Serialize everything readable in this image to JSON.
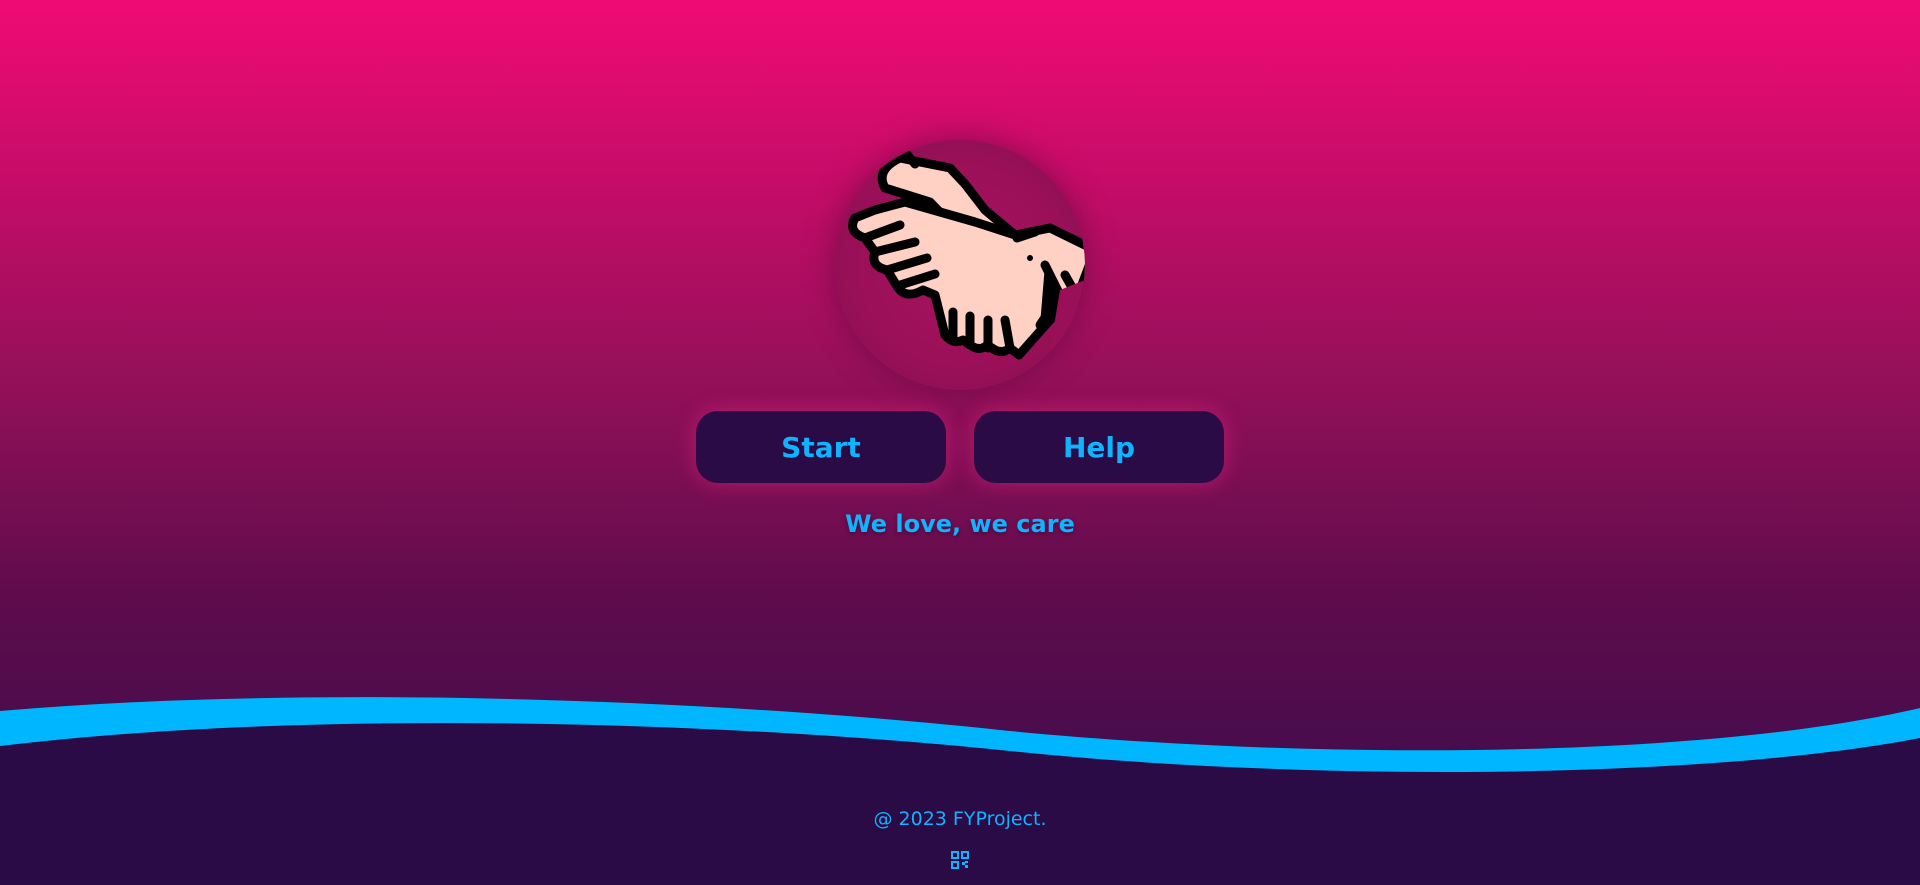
{
  "actions": {
    "start_label": "Start",
    "help_label": "Help"
  },
  "tagline": "We love, we care",
  "footer": {
    "copyright": "@ 2023 FYProject.",
    "qr_icon": "qr-code-icon"
  },
  "logo": {
    "icon": "handshake-icon"
  },
  "colors": {
    "accent": "#0fb3ff",
    "button_bg": "#2a0b45",
    "gradient_top": "#f00b74",
    "gradient_bottom": "#2a0b45",
    "wave": "#00b7ff"
  }
}
